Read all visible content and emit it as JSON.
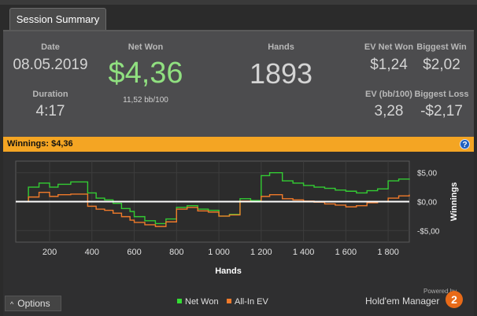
{
  "tab": {
    "label": "Session Summary"
  },
  "stats": {
    "date_label": "Date",
    "date_value": "08.05.2019",
    "duration_label": "Duration",
    "duration_value": "4:17",
    "netwon_label": "Net Won",
    "netwon_value": "$4,36",
    "netwon_sub": "11,52 bb/100",
    "hands_label": "Hands",
    "hands_value": "1893",
    "evnet_label": "EV Net Won",
    "evnet_value": "$1,24",
    "evbb_label": "EV (bb/100)",
    "evbb_value": "3,28",
    "bigwin_label": "Biggest Win",
    "bigwin_value": "$2,02",
    "bigloss_label": "Biggest Loss",
    "bigloss_value": "-$2,17"
  },
  "winnings_bar": {
    "label": "Winnings:",
    "value": "$4,36",
    "help": "?"
  },
  "chart_data": {
    "type": "line",
    "xlabel": "Hands",
    "ylabel": "Winnings",
    "xlim": [
      40,
      1900
    ],
    "ylim": [
      -7,
      7
    ],
    "xticks": [
      200,
      400,
      600,
      800,
      1000,
      1200,
      1400,
      1600,
      1800
    ],
    "xtick_labels": [
      "200",
      "400",
      "600",
      "800",
      "1 000",
      "1 200",
      "1 400",
      "1 600",
      "1 800"
    ],
    "yticks": [
      5,
      0,
      -5
    ],
    "ytick_labels": [
      "$5,00",
      "$0,00",
      "-$5,00"
    ],
    "zero_line": true,
    "series": [
      {
        "name": "Net Won",
        "color": "#33cc33",
        "x": [
          40,
          80,
          100,
          150,
          200,
          240,
          300,
          380,
          420,
          460,
          500,
          540,
          580,
          600,
          650,
          700,
          750,
          800,
          850,
          900,
          950,
          1000,
          1050,
          1100,
          1150,
          1200,
          1240,
          1300,
          1350,
          1400,
          1450,
          1500,
          1550,
          1600,
          1650,
          1700,
          1750,
          1800,
          1850,
          1900
        ],
        "y": [
          0,
          0,
          2.5,
          3.2,
          2.5,
          3.0,
          3.4,
          1.5,
          0.6,
          0.3,
          -0.3,
          -1.2,
          -1.7,
          -2.6,
          -3.3,
          -3.8,
          -3.0,
          -1.0,
          -0.7,
          -1.3,
          -1.5,
          -2.5,
          -2.2,
          0.5,
          0.2,
          4.5,
          5.0,
          3.6,
          3.2,
          2.8,
          2.5,
          2.3,
          2.0,
          1.8,
          1.5,
          1.9,
          2.2,
          3.6,
          3.9,
          3.8
        ]
      },
      {
        "name": "All-In EV",
        "color": "#f07a2a",
        "x": [
          40,
          80,
          100,
          150,
          200,
          240,
          300,
          380,
          420,
          460,
          500,
          540,
          580,
          600,
          650,
          700,
          750,
          800,
          850,
          900,
          950,
          1000,
          1050,
          1100,
          1150,
          1200,
          1240,
          1300,
          1350,
          1400,
          1450,
          1500,
          1550,
          1600,
          1650,
          1700,
          1750,
          1800,
          1850,
          1900
        ],
        "y": [
          0,
          0,
          0.8,
          1.6,
          0.9,
          1.2,
          1.3,
          -0.8,
          -1.3,
          -1.5,
          -2.0,
          -2.6,
          -3.2,
          -3.6,
          -4.0,
          -4.3,
          -3.5,
          -1.3,
          -1.0,
          -1.6,
          -1.8,
          -2.5,
          -2.3,
          0.1,
          0.0,
          0.9,
          1.2,
          0.5,
          0.3,
          0.1,
          -0.1,
          -0.4,
          -0.6,
          -0.9,
          -0.7,
          -0.2,
          0.0,
          0.6,
          1.0,
          1.2
        ]
      }
    ]
  },
  "legend": {
    "net_won": "Net Won",
    "allin_ev": "All-In EV"
  },
  "footer": {
    "options_label": "Options",
    "powered_by": "Powered by",
    "brand": "Hold'em Manager",
    "brand_number": "2"
  }
}
